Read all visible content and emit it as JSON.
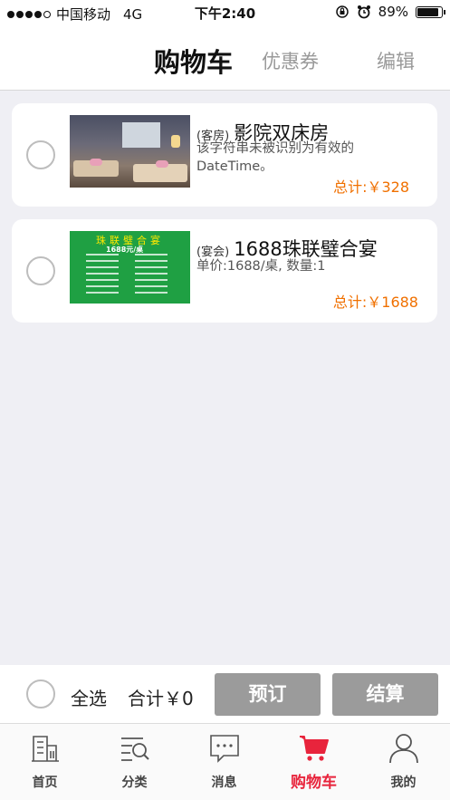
{
  "status_bar": {
    "carrier": "中国移动",
    "network": "4G",
    "time": "下午2:40",
    "battery": "89%",
    "signal_bars_filled": 4,
    "signal_bars_total": 5,
    "battery_level": 0.89
  },
  "header": {
    "title": "购物车",
    "coupon": "优惠券",
    "edit": "编辑"
  },
  "items": [
    {
      "category": "(客房)",
      "name": "影院双床房",
      "description": "该字符串未被识别为有效的 DateTime。",
      "total": "总计:￥328",
      "image_icon": "hotel-room-photo"
    },
    {
      "category": "(宴会)",
      "name": "1688珠联璧合宴",
      "description": "单价:1688/桌, 数量:1",
      "total": "总计:￥1688",
      "image_icon": "banquet-menu-photo",
      "image_title": "珠联璧合宴",
      "image_subtitle": "1688元/桌"
    }
  ],
  "footer": {
    "select_all": "全选",
    "sum": "合计￥0",
    "book_button": "预订",
    "checkout_button": "结算"
  },
  "tabs": [
    {
      "label": "首页",
      "icon": "home-icon"
    },
    {
      "label": "分类",
      "icon": "category-icon"
    },
    {
      "label": "消息",
      "icon": "message-icon"
    },
    {
      "label": "购物车",
      "icon": "cart-icon"
    },
    {
      "label": "我的",
      "icon": "profile-icon"
    }
  ],
  "colors": {
    "accent": "#e8243c",
    "price": "#f07000",
    "button_disabled": "#9b9b9b"
  }
}
